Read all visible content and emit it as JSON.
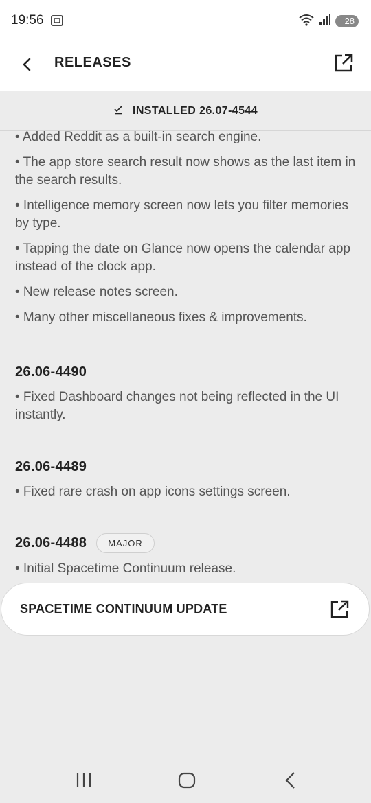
{
  "status": {
    "time": "19:56",
    "wifi_label": "6",
    "battery": "28"
  },
  "app_bar": {
    "title": "RELEASES"
  },
  "installed": {
    "label": "INSTALLED 26.07-4544"
  },
  "releases_top_bullets": [
    "• Added Reddit as a built-in search engine.",
    "• The app store search result now shows as the last item in the search results.",
    "• Intelligence memory screen now lets you filter memories by type.",
    "• Tapping the date on Glance now opens the calendar app instead of the clock app.",
    "• New release notes screen.",
    "• Many other miscellaneous fixes & improvements."
  ],
  "releases": [
    {
      "version": "26.06-4490",
      "bullets": [
        "• Fixed Dashboard changes not being reflected in the UI instantly."
      ]
    },
    {
      "version": "26.06-4489",
      "bullets": [
        "• Fixed rare crash on app icons settings screen."
      ]
    },
    {
      "version": "26.06-4488",
      "badge": "MAJOR",
      "bullets": [
        "• Initial Spacetime Continuum release."
      ]
    }
  ],
  "update_card": {
    "label": "SPACETIME CONTINUUM UPDATE"
  }
}
